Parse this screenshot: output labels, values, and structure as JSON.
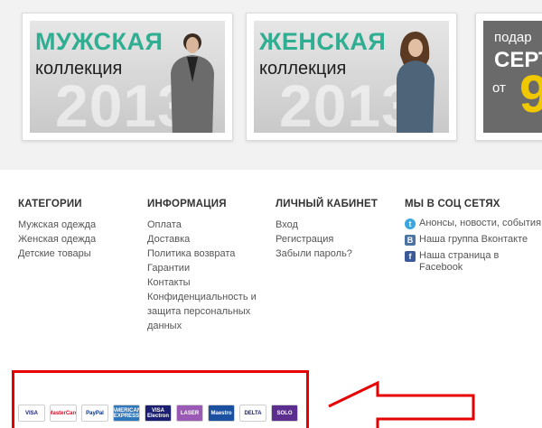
{
  "banners": [
    {
      "title": "МУЖСКАЯ",
      "subtitle": "коллекция",
      "year": "2013"
    },
    {
      "title": "ЖЕНСКАЯ",
      "subtitle": "коллекция",
      "year": "2013"
    }
  ],
  "gift_banner": {
    "line1": "подар",
    "line2": "СЕРТ",
    "line3": "от",
    "amount": "9"
  },
  "footer": {
    "categories": {
      "heading": "КАТЕГОРИИ",
      "links": [
        "Мужская одежда",
        "Женская одежда",
        "Детские товары"
      ]
    },
    "info": {
      "heading": "ИНФОРМАЦИЯ",
      "links": [
        "Оплата",
        "Доставка",
        "Политика возврата",
        "Гарантии",
        "Контакты",
        "Конфиденциальность и защита персональных данных"
      ]
    },
    "account": {
      "heading": "ЛИЧНЫЙ КАБИНЕТ",
      "links": [
        "Вход",
        "Регистрация",
        "Забыли пароль?"
      ]
    },
    "social": {
      "heading": "МЫ В СОЦ СЕТЯХ",
      "items": [
        "Анонсы, новости, события",
        "Наша группа Вконтакте",
        "Наша страница в Facebook"
      ]
    }
  },
  "payments": [
    {
      "name": "visa-icon",
      "label": "VISA",
      "bg": "#ffffff",
      "fg": "#1a1f71"
    },
    {
      "name": "mastercard-icon",
      "label": "MasterCard",
      "bg": "#ffffff",
      "fg": "#eb001b"
    },
    {
      "name": "paypal-icon",
      "label": "PayPal",
      "bg": "#ffffff",
      "fg": "#003087"
    },
    {
      "name": "american-express-icon",
      "label": "AMERICAN EXPRESS",
      "bg": "#2e77bb",
      "fg": "#ffffff"
    },
    {
      "name": "visa-electron-icon",
      "label": "VISA Electron",
      "bg": "#1a1f71",
      "fg": "#ffffff"
    },
    {
      "name": "laser-icon",
      "label": "LASER",
      "bg": "#9b59b6",
      "fg": "#ffffff"
    },
    {
      "name": "maestro-icon",
      "label": "Maestro",
      "bg": "#1b4fa0",
      "fg": "#ffffff"
    },
    {
      "name": "delta-icon",
      "label": "DELTA",
      "bg": "#ffffff",
      "fg": "#1a1f71"
    },
    {
      "name": "solo-icon",
      "label": "SOLO",
      "bg": "#5b2d8e",
      "fg": "#ffffff"
    }
  ],
  "colors": {
    "accent_green": "#2fae92",
    "highlight_red": "#e60000",
    "gift_yellow": "#f0c800"
  }
}
